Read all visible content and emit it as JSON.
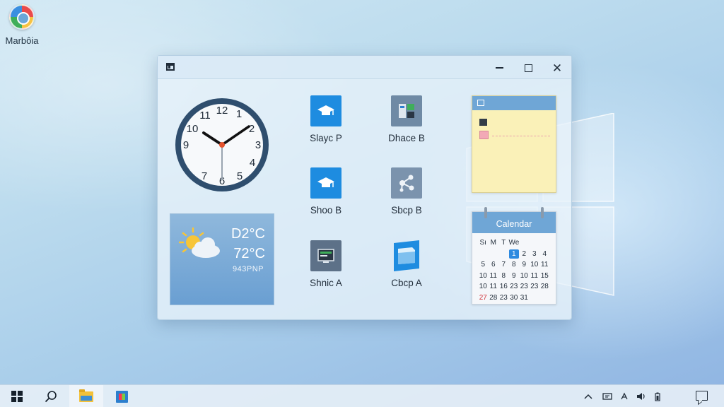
{
  "desktop": {
    "icon_label": "Marbôia"
  },
  "clock": {
    "numbers": [
      "12",
      "1",
      "2",
      "3",
      "4",
      "5",
      "6",
      "7",
      "8",
      "9",
      "10",
      "11"
    ]
  },
  "weather": {
    "temp_primary": "D2°C",
    "temp_secondary": "72°C",
    "detail": "943PNP"
  },
  "apps": [
    {
      "label": "Slayc P",
      "icon": "graduation-cap-icon"
    },
    {
      "label": "Dhace B",
      "icon": "dashboard-icon"
    },
    {
      "label": "Shoo B",
      "icon": "graduation-cap-icon"
    },
    {
      "label": "Sbcp B",
      "icon": "network-icon"
    },
    {
      "label": "Shnic A",
      "icon": "monitor-icon"
    },
    {
      "label": "Cbcp A",
      "icon": "folder-icon"
    }
  ],
  "calendar": {
    "title": "Calendar",
    "days_header": [
      "Sı",
      "M",
      "T",
      "We",
      "",
      "",
      ""
    ],
    "rows": [
      [
        "",
        "",
        "",
        "",
        "",
        "",
        ""
      ],
      [
        "",
        "",
        "",
        "1",
        "2",
        "3",
        "4"
      ],
      [
        "5",
        "6",
        "7",
        "8",
        "9",
        "10",
        "11"
      ],
      [
        "10",
        "11",
        "8",
        "9",
        "10",
        "11",
        "15"
      ],
      [
        "10",
        "11",
        "16",
        "23",
        "23",
        "23",
        "28"
      ],
      [
        "27",
        "28",
        "23",
        "30",
        "31",
        "",
        ""
      ]
    ]
  },
  "colors": {
    "accent": "#1e8ce0",
    "window_bg": "#e8f2fa",
    "note": "#faf1b8",
    "calendar_header": "#6fa6d6"
  }
}
